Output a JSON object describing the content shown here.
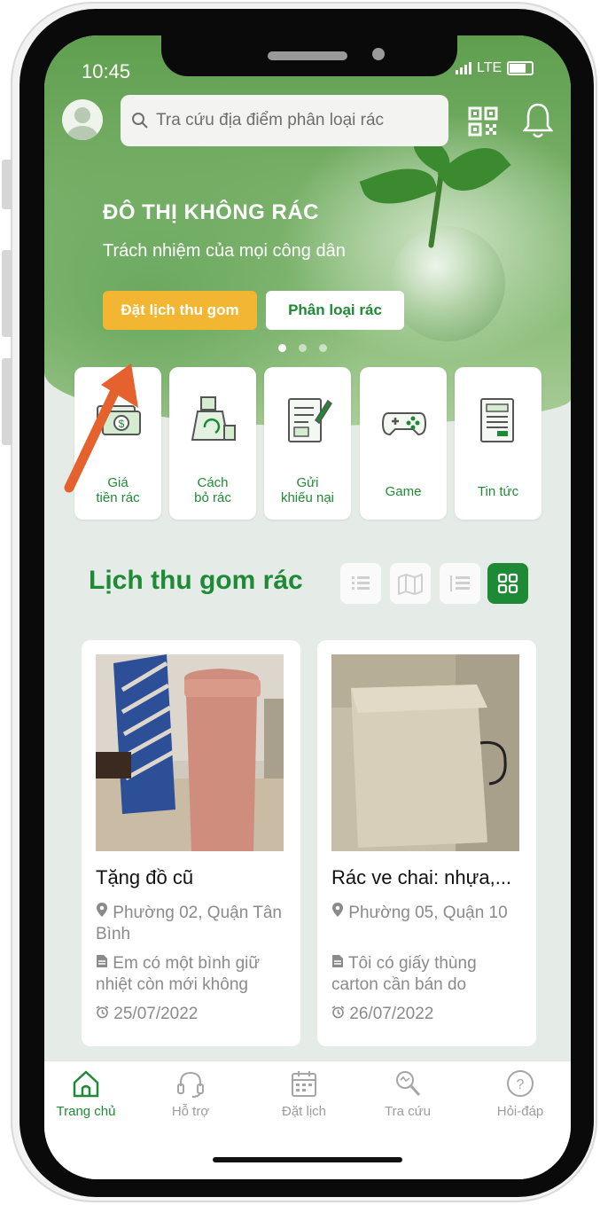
{
  "status_bar": {
    "time": "10:45",
    "network": "LTE"
  },
  "search": {
    "placeholder": "Tra cứu địa điểm phân loại rác"
  },
  "banner": {
    "title": "ĐÔ THỊ KHÔNG RÁC",
    "subtitle": "Trách nhiệm của mọi công dân",
    "primary_button": "Đặt lịch thu gom",
    "secondary_button": "Phân loại rác",
    "slides": 3,
    "active_slide": 1
  },
  "features": [
    {
      "label_line1": "Giá",
      "label_line2": "tiền rác",
      "icon": "money-icon"
    },
    {
      "label_line1": "Cách",
      "label_line2": "bỏ rác",
      "icon": "recycle-bag-icon"
    },
    {
      "label_line1": "Gửi",
      "label_line2": "khiếu nại",
      "icon": "complaint-form-icon"
    },
    {
      "label_line1": "Game",
      "label_line2": "",
      "icon": "gamepad-icon"
    },
    {
      "label_line1": "Tin tức",
      "label_line2": "",
      "icon": "newspaper-icon"
    }
  ],
  "section": {
    "title": "Lịch thu gom rác",
    "views": [
      "list-view-icon",
      "map-view-icon",
      "numbered-list-icon",
      "grid-view-icon"
    ],
    "active_view": "grid-view-icon"
  },
  "cards": [
    {
      "title": "Tặng đồ cũ",
      "location": "Phường 02, Quận Tân Bình",
      "description": "Em có một bình giữ nhiệt còn mới không",
      "date": "25/07/2022"
    },
    {
      "title": "Rác ve chai: nhựa,...",
      "location": "Phường 05, Quận 10",
      "description": "Tôi có giấy thùng carton cần bán do",
      "date": "26/07/2022"
    }
  ],
  "tabs": [
    {
      "label": "Trang chủ",
      "icon": "home-icon",
      "active": true
    },
    {
      "label": "Hỗ trợ",
      "icon": "headset-icon",
      "active": false
    },
    {
      "label": "Đặt lịch",
      "icon": "calendar-icon",
      "active": false
    },
    {
      "label": "Tra cứu",
      "icon": "search-map-icon",
      "active": false
    },
    {
      "label": "Hỏi-đáp",
      "icon": "question-icon",
      "active": false
    }
  ],
  "colors": {
    "brand_green": "#1f8a35",
    "accent_yellow": "#f2b632",
    "annotation_arrow": "#e5612e"
  }
}
